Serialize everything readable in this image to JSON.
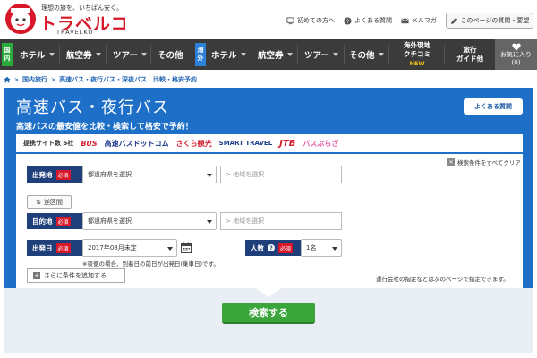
{
  "header": {
    "tagline": "理想の旅を、いちばん安く。",
    "logo_title": "トラベルコ",
    "logo_sub": "TRAVELKO",
    "util_links": [
      {
        "label": "初めての方へ",
        "icon": "monitor-icon"
      },
      {
        "label": "よくある質問",
        "icon": "question-icon"
      },
      {
        "label": "メルマガ",
        "icon": "mail-icon"
      }
    ],
    "share_label": "このページの質問・要望"
  },
  "nav": {
    "domestic_badge": [
      "国",
      "内"
    ],
    "overseas_badge": [
      "海",
      "外"
    ],
    "domestic_items": [
      "ホテル",
      "航空券",
      "ツアー",
      "その他"
    ],
    "overseas_items": [
      "ホテル",
      "航空券",
      "ツアー",
      "その他"
    ],
    "kuchikomi": [
      "海外現地",
      "クチコミ"
    ],
    "kuchikomi_new": "NEW",
    "guide": [
      "旅行",
      "ガイド他"
    ],
    "favorites": [
      "お気に入り",
      "(0)"
    ]
  },
  "breadcrumb": [
    "国内旅行",
    "高速バス・夜行バス・深夜バス　比較・格安予約"
  ],
  "panel": {
    "title": "高速バス・夜行バス",
    "lead": "高速バスの最安値を比較・検索して格安で予約！",
    "faq_label": "よくある質問"
  },
  "partners": {
    "label": "提携サイト数 6社",
    "items": [
      "BUS",
      "高速バスドットコム",
      "さくら観光",
      "SMART TRAVEL",
      "JTB",
      "バスぷらざ"
    ]
  },
  "form": {
    "clear_label": "検索条件をすべてクリア",
    "departure_label": "出発地",
    "arrival_label": "目的地",
    "date_label": "出発日",
    "people_label": "人数",
    "required": "必須",
    "help": "?",
    "pref_placeholder": "都道府県を選択",
    "area_placeholder": "> 地域を選択",
    "swap_label": "逆区間",
    "date_value": "2017年08月未定",
    "people_value": "1名",
    "date_note": "※夜便の場合、到着日の前日が出発日(乗車日)です。",
    "add_condition": "さらに条件を追加する",
    "ops_note": "運行会社の指定などは次のページで指定できます。",
    "search_button": "検索する"
  },
  "colors": {
    "brand_red": "#d6182a",
    "panel_blue": "#1e6fc8",
    "nav_dark": "#3b3b3b",
    "search_green": "#3aa53a"
  }
}
